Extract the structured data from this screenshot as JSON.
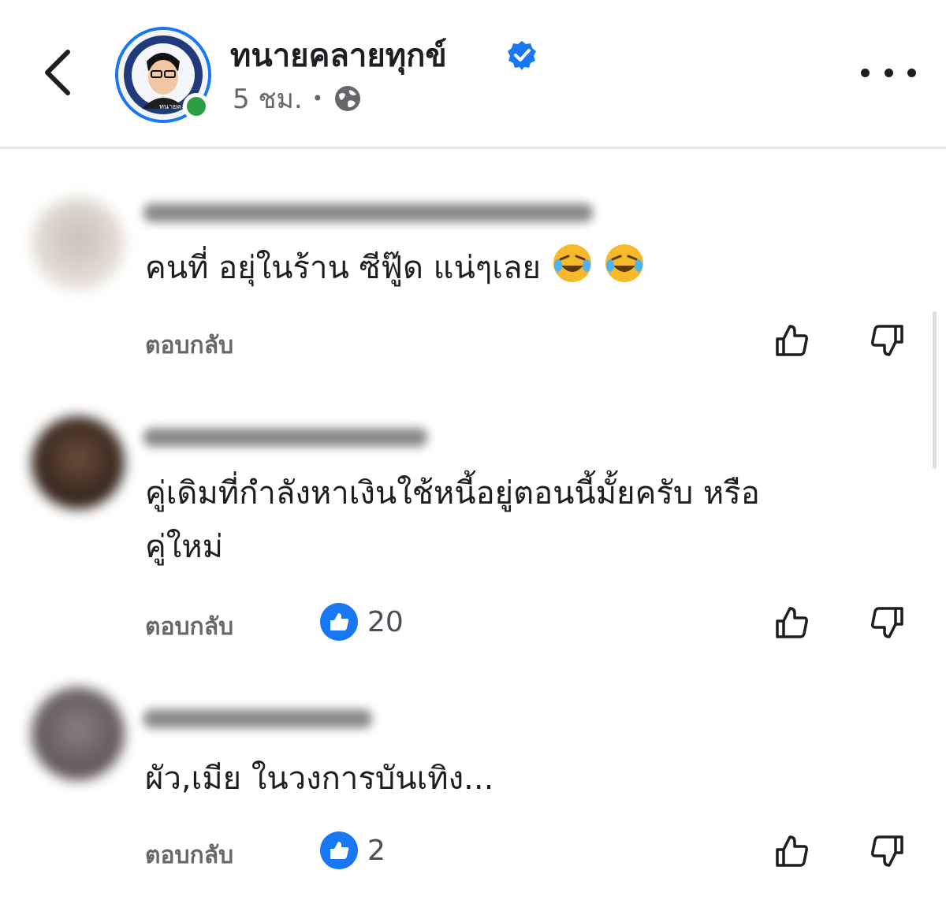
{
  "header": {
    "page_name": "ทนายคลายทุกข์",
    "time": "5 ชม.",
    "separator": "•",
    "icons": {
      "back": "chevron-left-icon",
      "verified": "verified-badge-icon",
      "audience": "globe-icon",
      "more": "more-dots-icon"
    },
    "avatar_text": "ทนายคลายทุกข์"
  },
  "comments": [
    {
      "text": "คนที่ อยุ่ในร้าน ซีฟู๊ด แน่ๆเลย",
      "emoji": [
        "rolling-on-floor-laughing",
        "rolling-on-floor-laughing"
      ],
      "reply_label": "ตอบกลับ",
      "like_count": ""
    },
    {
      "text_line1": "คู่เดิมที่กำลังหาเงินใช้หนี้อยู่ตอนนี้มั้ยครับ หรือ",
      "text_line2": "คู่ใหม่",
      "reply_label": "ตอบกลับ",
      "like_count": "20"
    },
    {
      "text": "ผัว,เมีย ในวงการบันเทิง...",
      "reply_label": "ตอบกลับ",
      "like_count": "2"
    }
  ],
  "colors": {
    "accent": "#1877f2",
    "online": "#2e9e44",
    "muted": "#65676b",
    "text": "#1c1e21"
  }
}
